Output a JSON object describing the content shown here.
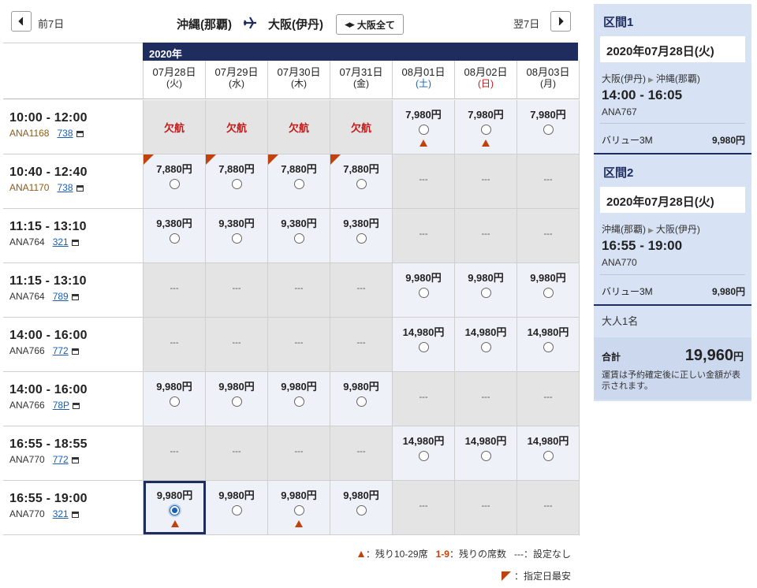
{
  "nav": {
    "prev_label": "前7日",
    "next_label": "翌7日",
    "origin": "沖縄(那覇)",
    "destination": "大阪(伊丹)",
    "all_button": "大阪全て"
  },
  "table": {
    "year": "2020年",
    "dates": [
      {
        "date": "07月28日",
        "weekday": "(火)",
        "type": "weekday"
      },
      {
        "date": "07月29日",
        "weekday": "(水)",
        "type": "weekday"
      },
      {
        "date": "07月30日",
        "weekday": "(木)",
        "type": "weekday"
      },
      {
        "date": "07月31日",
        "weekday": "(金)",
        "type": "weekday"
      },
      {
        "date": "08月01日",
        "weekday": "(土)",
        "type": "sat"
      },
      {
        "date": "08月02日",
        "weekday": "(日)",
        "type": "sun"
      },
      {
        "date": "08月03日",
        "weekday": "(月)",
        "type": "weekday"
      }
    ],
    "rows": [
      {
        "time": "10:00 - 12:00",
        "flight": "ANA1168",
        "equipment": "738",
        "flight_color": "brown",
        "cells": [
          {
            "kind": "cancel",
            "text": "欠航"
          },
          {
            "kind": "cancel",
            "text": "欠航"
          },
          {
            "kind": "cancel",
            "text": "欠航"
          },
          {
            "kind": "cancel",
            "text": "欠航"
          },
          {
            "kind": "price",
            "price": "7,980円",
            "few": true
          },
          {
            "kind": "price",
            "price": "7,980円",
            "few": true
          },
          {
            "kind": "price",
            "price": "7,980円"
          }
        ]
      },
      {
        "time": "10:40 - 12:40",
        "flight": "ANA1170",
        "equipment": "738",
        "flight_color": "brown",
        "cells": [
          {
            "kind": "price",
            "price": "7,880円",
            "cheapest": true
          },
          {
            "kind": "price",
            "price": "7,880円",
            "cheapest": true
          },
          {
            "kind": "price",
            "price": "7,880円",
            "cheapest": true
          },
          {
            "kind": "price",
            "price": "7,880円",
            "cheapest": true
          },
          {
            "kind": "none",
            "text": "---"
          },
          {
            "kind": "none",
            "text": "---"
          },
          {
            "kind": "none",
            "text": "---"
          }
        ]
      },
      {
        "time": "11:15 - 13:10",
        "flight": "ANA764",
        "equipment": "321",
        "cells": [
          {
            "kind": "price",
            "price": "9,380円"
          },
          {
            "kind": "price",
            "price": "9,380円"
          },
          {
            "kind": "price",
            "price": "9,380円"
          },
          {
            "kind": "price",
            "price": "9,380円"
          },
          {
            "kind": "none",
            "text": "---"
          },
          {
            "kind": "none",
            "text": "---"
          },
          {
            "kind": "none",
            "text": "---"
          }
        ]
      },
      {
        "time": "11:15 - 13:10",
        "flight": "ANA764",
        "equipment": "789",
        "cells": [
          {
            "kind": "none",
            "text": "---"
          },
          {
            "kind": "none",
            "text": "---"
          },
          {
            "kind": "none",
            "text": "---"
          },
          {
            "kind": "none",
            "text": "---"
          },
          {
            "kind": "price",
            "price": "9,980円"
          },
          {
            "kind": "price",
            "price": "9,980円"
          },
          {
            "kind": "price",
            "price": "9,980円"
          }
        ]
      },
      {
        "time": "14:00 - 16:00",
        "flight": "ANA766",
        "equipment": "772",
        "cells": [
          {
            "kind": "none",
            "text": "---"
          },
          {
            "kind": "none",
            "text": "---"
          },
          {
            "kind": "none",
            "text": "---"
          },
          {
            "kind": "none",
            "text": "---"
          },
          {
            "kind": "price",
            "price": "14,980円"
          },
          {
            "kind": "price",
            "price": "14,980円"
          },
          {
            "kind": "price",
            "price": "14,980円"
          }
        ]
      },
      {
        "time": "14:00 - 16:00",
        "flight": "ANA766",
        "equipment": "78P",
        "cells": [
          {
            "kind": "price",
            "price": "9,980円"
          },
          {
            "kind": "price",
            "price": "9,980円"
          },
          {
            "kind": "price",
            "price": "9,980円"
          },
          {
            "kind": "price",
            "price": "9,980円"
          },
          {
            "kind": "none",
            "text": "---"
          },
          {
            "kind": "none",
            "text": "---"
          },
          {
            "kind": "none",
            "text": "---"
          }
        ]
      },
      {
        "time": "16:55 - 18:55",
        "flight": "ANA770",
        "equipment": "772",
        "cells": [
          {
            "kind": "none",
            "text": "---"
          },
          {
            "kind": "none",
            "text": "---"
          },
          {
            "kind": "none",
            "text": "---"
          },
          {
            "kind": "none",
            "text": "---"
          },
          {
            "kind": "price",
            "price": "14,980円"
          },
          {
            "kind": "price",
            "price": "14,980円"
          },
          {
            "kind": "price",
            "price": "14,980円"
          }
        ]
      },
      {
        "time": "16:55 - 19:00",
        "flight": "ANA770",
        "equipment": "321",
        "cells": [
          {
            "kind": "price",
            "price": "9,980円",
            "selected": true,
            "few": true
          },
          {
            "kind": "price",
            "price": "9,980円"
          },
          {
            "kind": "price",
            "price": "9,980円",
            "few": true
          },
          {
            "kind": "price",
            "price": "9,980円"
          },
          {
            "kind": "none",
            "text": "---"
          },
          {
            "kind": "none",
            "text": "---"
          },
          {
            "kind": "none",
            "text": "---"
          }
        ]
      }
    ]
  },
  "legend": {
    "few_seats": "：残り10-29席",
    "seat_count_sample": "1-9",
    "seat_count": "：残りの席数",
    "none_sample": "---",
    "none_label": "：設定なし",
    "cheapest": "：指定日最安"
  },
  "summary": {
    "segments": [
      {
        "title": "区間1",
        "date": "2020年07月28日(火)",
        "from": "大阪(伊丹)",
        "to": "沖縄(那覇)",
        "time": "14:00 - 16:05",
        "flight": "ANA767",
        "fare_name": "バリュー3M",
        "fare_price": "9,980円"
      },
      {
        "title": "区間2",
        "date": "2020年07月28日(火)",
        "from": "沖縄(那覇)",
        "to": "大阪(伊丹)",
        "time": "16:55 - 19:00",
        "flight": "ANA770",
        "fare_name": "バリュー3M",
        "fare_price": "9,980円"
      }
    ],
    "passengers": "大人1名",
    "total_label": "合計",
    "total_value": "19,960",
    "total_unit": "円",
    "note": "運賃は予約確定後に正しい金額が表示されます。"
  },
  "colors": {
    "navy": "#1e2c5e",
    "accent_red": "#c41a1a",
    "flag_orange": "#c0420f",
    "link_blue": "#1a5fb4"
  }
}
